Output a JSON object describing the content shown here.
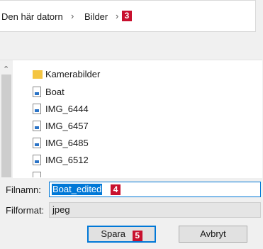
{
  "breadcrumb": {
    "items": [
      "Den här datorn",
      "Bilder"
    ],
    "step_badge": "3"
  },
  "files": [
    {
      "name": "Kamerabilder",
      "icon": "folder-icon"
    },
    {
      "name": "Boat",
      "icon": "image-file-icon"
    },
    {
      "name": "IMG_6444",
      "icon": "image-file-icon"
    },
    {
      "name": "IMG_6457",
      "icon": "image-file-icon"
    },
    {
      "name": "IMG_6485",
      "icon": "image-file-icon"
    },
    {
      "name": "IMG_6512",
      "icon": "image-file-icon"
    }
  ],
  "form": {
    "filename_label": "Filnamn:",
    "filename_value": "Boat_edited",
    "filename_badge": "4",
    "filetype_label": "Filformat:",
    "filetype_value": "jpeg"
  },
  "buttons": {
    "save_label": "Spara",
    "save_badge": "5",
    "cancel_label": "Avbryt"
  },
  "colors": {
    "badge": "#c8102e",
    "selection": "#0078d7"
  }
}
